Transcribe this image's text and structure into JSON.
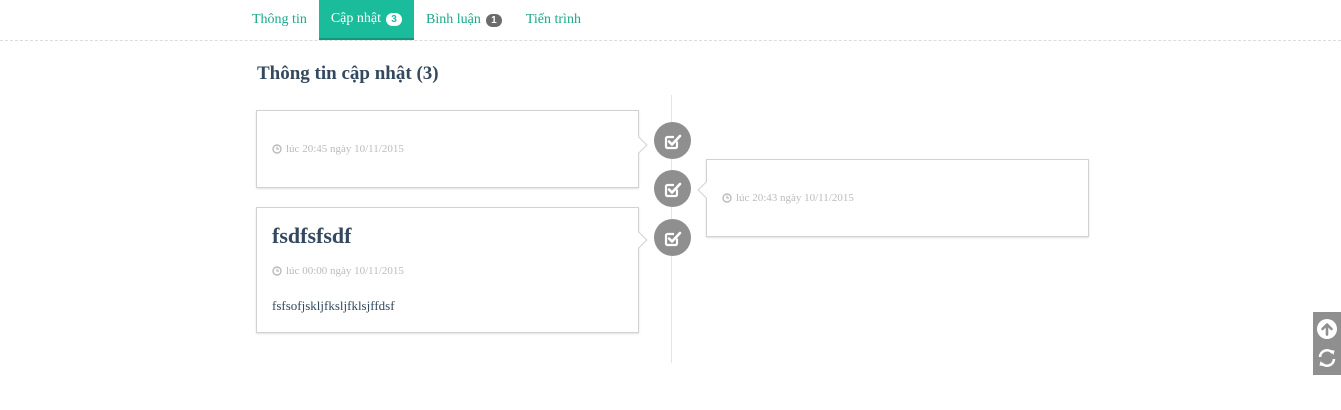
{
  "tabs": [
    {
      "label": "Thông tin",
      "badge": null,
      "active": false
    },
    {
      "label": "Cập nhật",
      "badge": "3",
      "active": true
    },
    {
      "label": "Bình luận",
      "badge": "1",
      "active": false
    },
    {
      "label": "Tiến trình",
      "badge": null,
      "active": false
    }
  ],
  "section": {
    "title": "Thông tin cập nhật (3)"
  },
  "updates": [
    {
      "title": "",
      "time": "lúc 20:45 ngày 10/11/2015",
      "body": ""
    },
    {
      "title": "",
      "time": "lúc 20:43 ngày 10/11/2015",
      "body": ""
    },
    {
      "title": "fsdfsfsdf",
      "time": "lúc 00:00 ngày 10/11/2015",
      "body": "fsfsofjskljfksljfklsjffdsf"
    }
  ],
  "icons": {
    "marker": "check-square-icon",
    "clock": "clock-icon",
    "scroll_top": "arrow-up-circle-icon",
    "refresh": "refresh-icon"
  },
  "colors": {
    "accent": "#1abc9c",
    "marker": "#8f8f8f",
    "text": "#34495e",
    "muted": "#bbbbbb"
  }
}
